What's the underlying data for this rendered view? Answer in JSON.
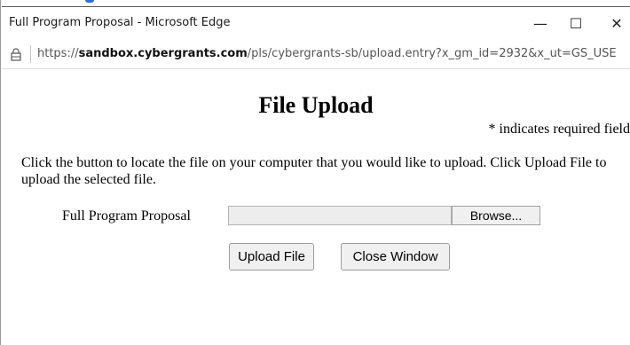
{
  "window": {
    "title": "Full Program Proposal - Microsoft Edge",
    "controls": {
      "minimize": "—",
      "maximize": "☐",
      "close": "✕"
    }
  },
  "address_bar": {
    "scheme": "https://",
    "host": "sandbox.cybergrants.com",
    "path": "/pls/cybergrants-sb/upload.entry?x_gm_id=2932&x_ut=GS_USE"
  },
  "page": {
    "title": "File Upload",
    "required_note": "* indicates required field",
    "instructions": "Click the button to locate the file on your computer that you would like to upload. Click Upload File to upload the selected file.",
    "field_label": "Full Program Proposal",
    "file_value": "",
    "browse_label": "Browse...",
    "upload_label": "Upload File",
    "close_label": "Close Window"
  },
  "icons": {
    "address": "lock-icon"
  }
}
